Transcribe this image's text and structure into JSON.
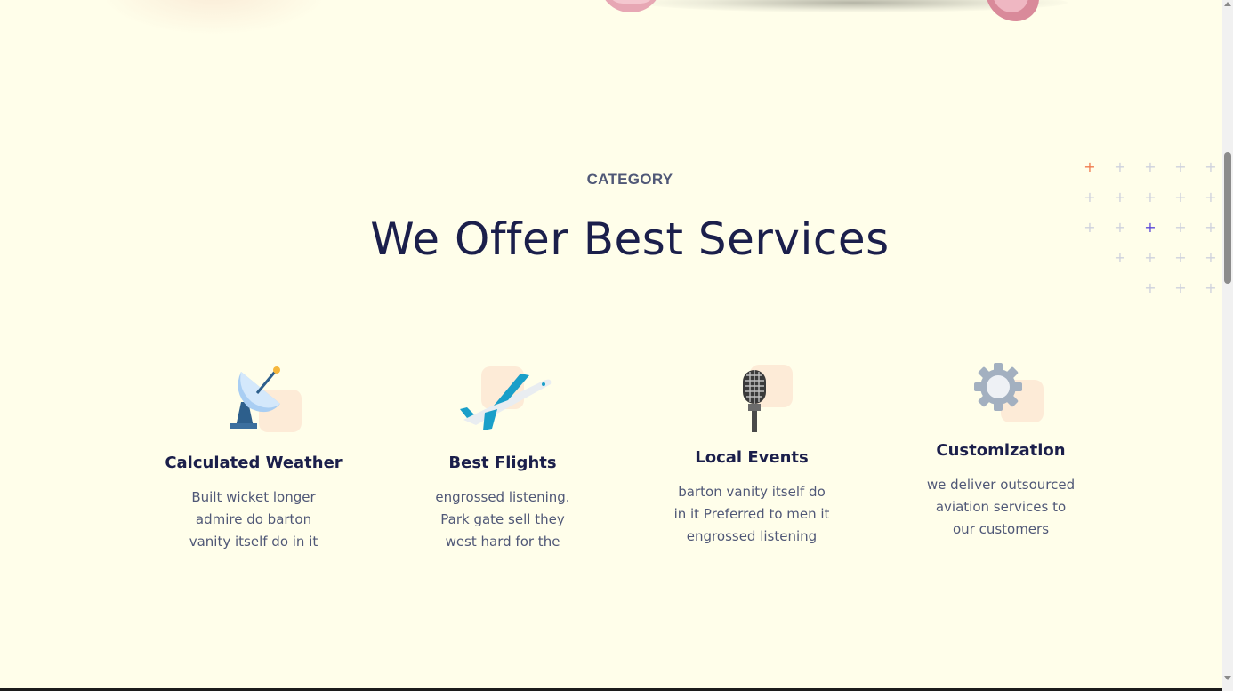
{
  "section": {
    "eyebrow": "CATEGORY",
    "title": "We Offer Best Services"
  },
  "services": [
    {
      "title": "Calculated Weather",
      "text": [
        "Built wicket longer",
        "admire do barton",
        "vanity itself do in it"
      ],
      "icon": "satellite-dish-icon"
    },
    {
      "title": "Best Flights",
      "text": [
        "engrossed listening.",
        "Park gate sell they",
        "west hard for the"
      ],
      "icon": "airplane-icon"
    },
    {
      "title": "Local Events",
      "text": [
        "barton vanity itself do",
        "in it Preferred to men it",
        "engrossed listening"
      ],
      "icon": "microphone-icon"
    },
    {
      "title": "Customization",
      "text": [
        "we deliver outsourced",
        "aviation services to",
        "our customers"
      ],
      "icon": "gear-icon"
    }
  ],
  "colors": {
    "background": "#fffeea",
    "heading": "#1b1f4b",
    "body_text": "#505877",
    "accent_peach": "#fdebd7",
    "plus_orange": "#f07b4f",
    "plus_purple": "#5b48d8",
    "plus_gray": "#cfd2dd"
  }
}
